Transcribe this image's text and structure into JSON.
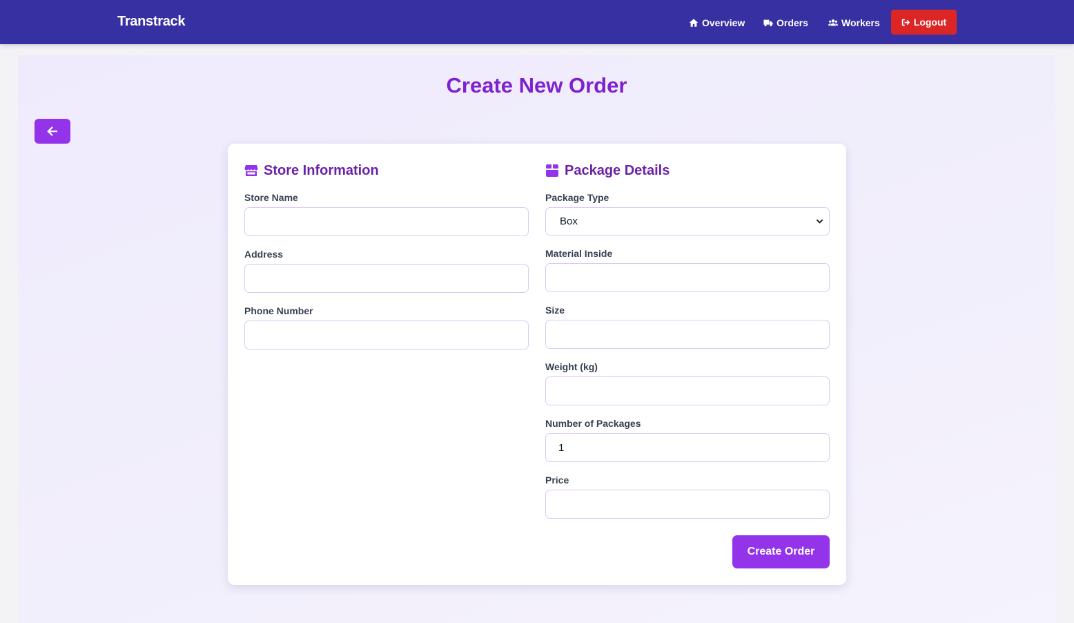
{
  "nav": {
    "brand": "Transtrack",
    "items": [
      {
        "label": "Overview",
        "icon": "home-icon"
      },
      {
        "label": "Orders",
        "icon": "truck-icon"
      },
      {
        "label": "Workers",
        "icon": "users-icon"
      }
    ],
    "logout_label": "Logout",
    "logout_icon": "sign-out-icon"
  },
  "page": {
    "title": "Create New Order",
    "back_icon": "arrow-left-icon"
  },
  "store": {
    "title": "Store Information",
    "icon": "store-icon",
    "fields": {
      "store_name": {
        "label": "Store Name",
        "value": ""
      },
      "address": {
        "label": "Address",
        "value": ""
      },
      "phone": {
        "label": "Phone Number",
        "value": ""
      }
    }
  },
  "package": {
    "title": "Package Details",
    "icon": "box-icon",
    "fields": {
      "type": {
        "label": "Package Type",
        "value": "Box"
      },
      "material": {
        "label": "Material Inside",
        "value": ""
      },
      "size": {
        "label": "Size",
        "value": ""
      },
      "weight": {
        "label": "Weight (kg)",
        "value": ""
      },
      "count": {
        "label": "Number of Packages",
        "value": "1"
      },
      "price": {
        "label": "Price",
        "value": ""
      }
    }
  },
  "actions": {
    "submit_label": "Create Order"
  },
  "colors": {
    "navbar": "#3730a3",
    "accent": "#9333ea",
    "title": "#7e22ce",
    "logout": "#dc2626"
  }
}
